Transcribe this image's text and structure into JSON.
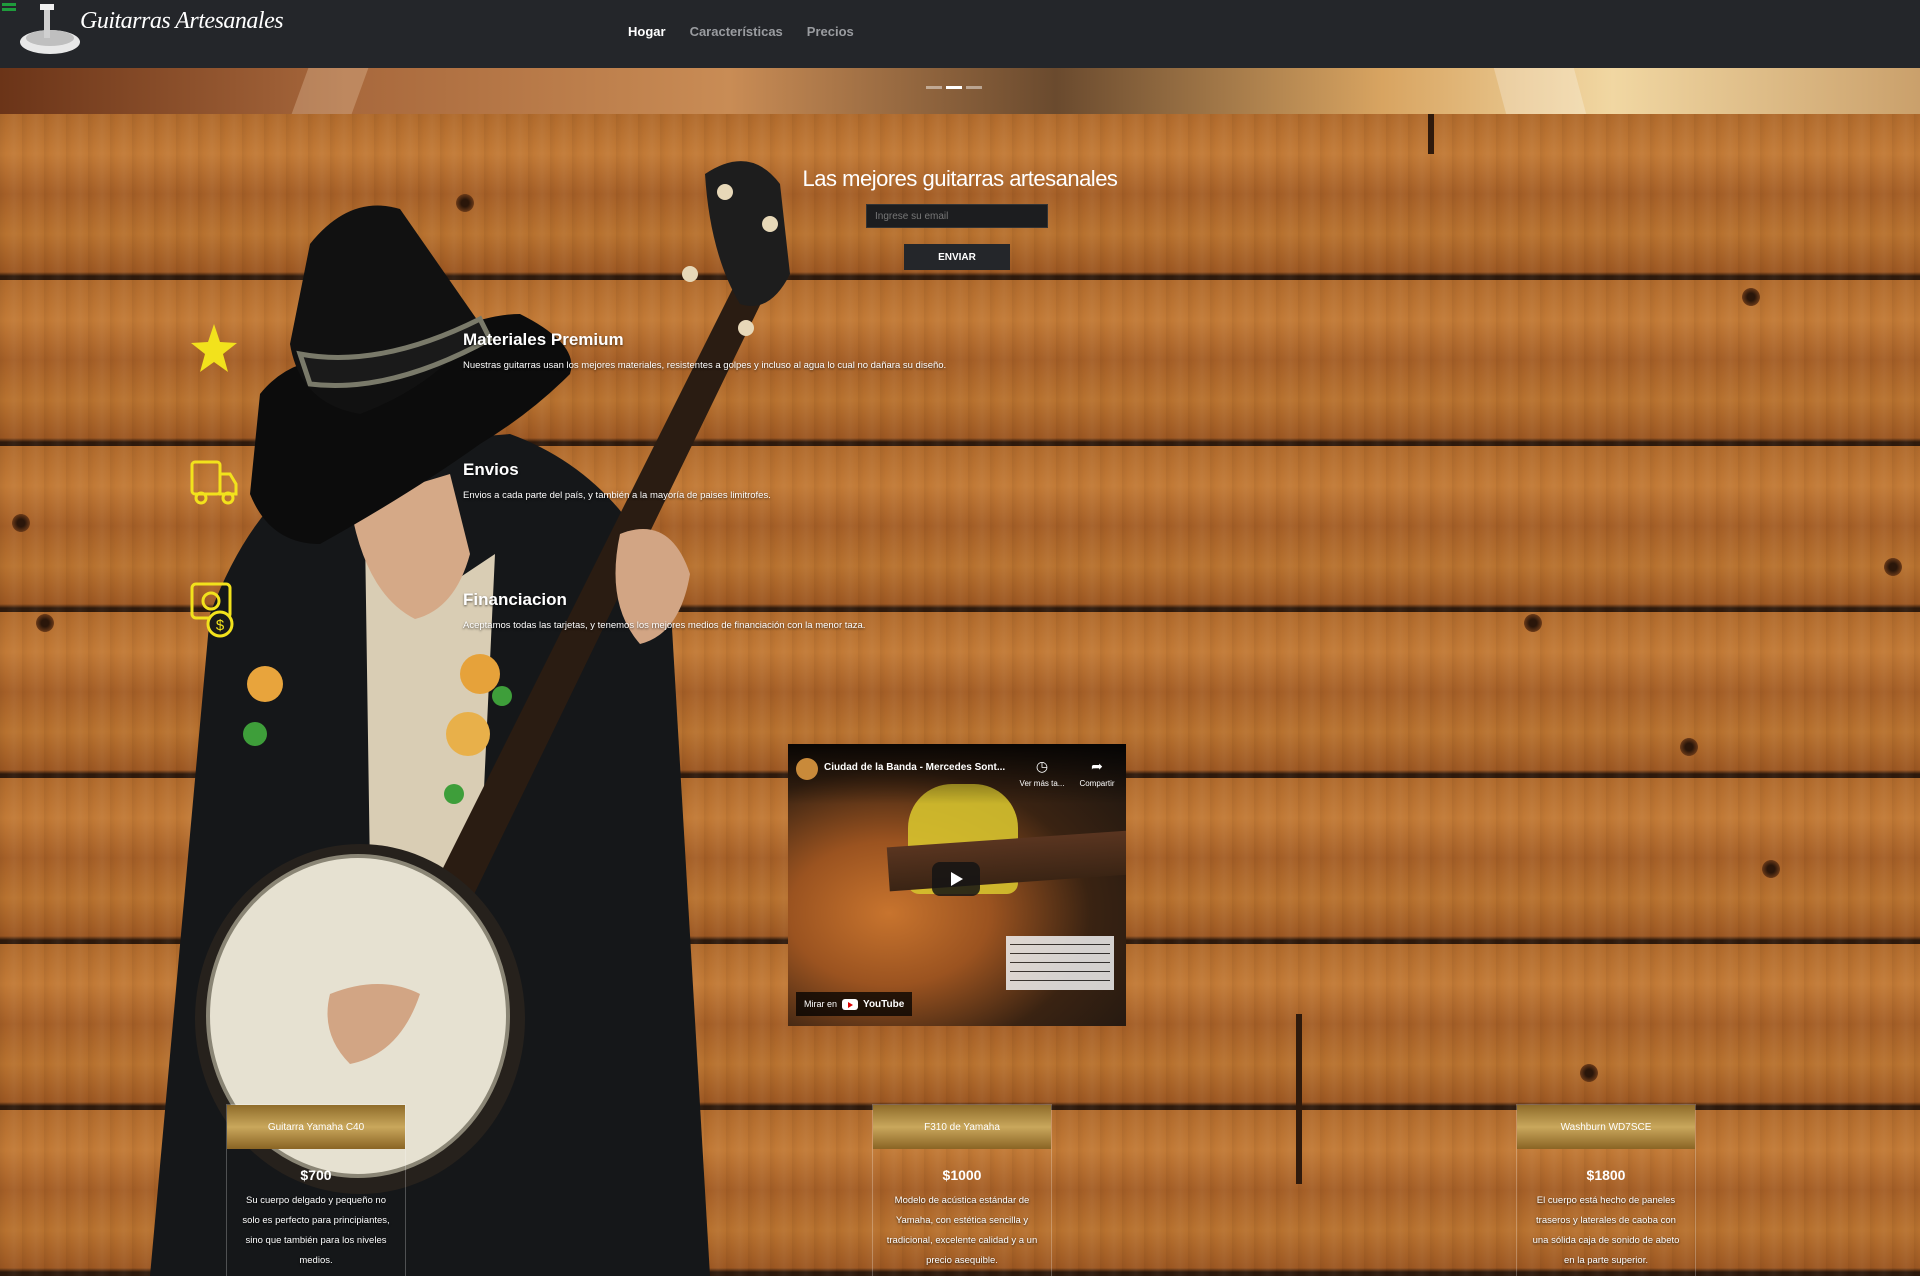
{
  "nav": {
    "brand": "Guitarras Artesanales",
    "links": [
      {
        "label": "Hogar",
        "active": true
      },
      {
        "label": "Características",
        "active": false
      },
      {
        "label": "Precios",
        "active": false
      }
    ]
  },
  "carousel": {
    "slide_count": 3,
    "active_index": 1
  },
  "hero": {
    "title": "Las mejores guitarras artesanales",
    "email_placeholder": "Ingrese su email",
    "send_label": "ENVIAR"
  },
  "features": [
    {
      "icon": "star-icon",
      "title": "Materiales Premium",
      "text": "Nuestras guitarras usan los mejores materiales, resistentes a golpes y incluso al agua lo cual no dañara su diseño."
    },
    {
      "icon": "truck-icon",
      "title": "Envios",
      "text": "Envios a cada parte del país, y también a la mayoría de paises limitrofes."
    },
    {
      "icon": "money-icon",
      "title": "Financiacion",
      "text": "Aceptamos todas las tarjetas, y tenemos los mejores medios de financiación con la menor taza."
    }
  ],
  "video": {
    "title": "Ciudad de la Banda - Mercedes Sont...",
    "watch_later": "Ver más ta...",
    "share": "Compartir",
    "watch_on": "Mirar en",
    "platform": "YouTube"
  },
  "pricing": [
    {
      "name": "Guitarra Yamaha C40",
      "price": "$700",
      "description": "Su cuerpo delgado y pequeño no solo es perfecto para principiantes, sino que también para los niveles medios."
    },
    {
      "name": "F310 de Yamaha",
      "price": "$1000",
      "description": "Modelo de acústica estándar de Yamaha, con estética sencilla y tradicional, excelente calidad y a un precio asequible."
    },
    {
      "name": "Washburn WD7SCE",
      "price": "$1800",
      "description": "El cuerpo está hecho de paneles traseros y laterales de caoba con una sólida caja de sonido de abeto en la parte superior."
    }
  ],
  "colors": {
    "navbar": "#24262a",
    "icon_yellow": "#f2e21c",
    "hamburger": "#1f9b3c"
  }
}
